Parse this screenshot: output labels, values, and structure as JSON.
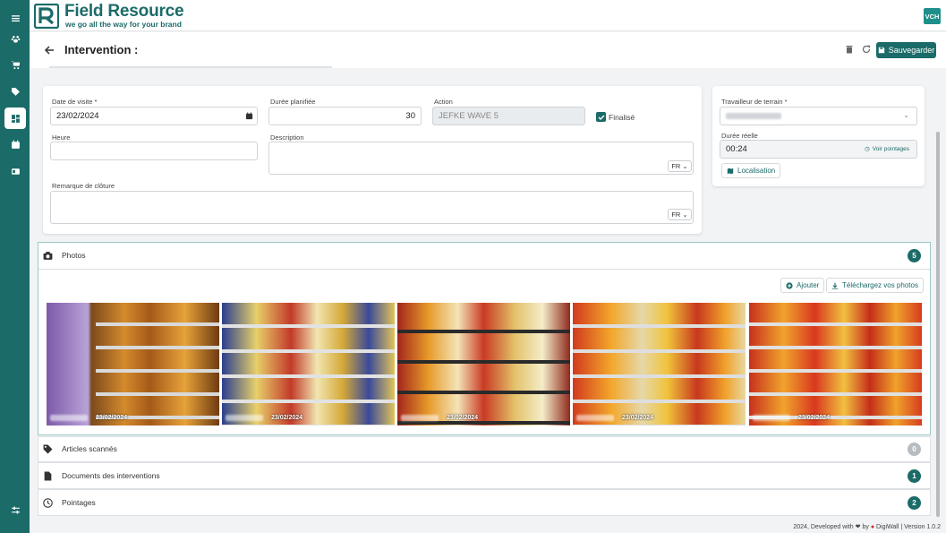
{
  "app": {
    "brand_name": "Field Resource",
    "brand_tagline": "we go all the way for your brand",
    "user_initials": "VCH"
  },
  "colors": {
    "primary": "#1b6b68",
    "badge_teal": "#1e8f8a",
    "badge_grey": "#b7bcc1"
  },
  "sidebar": {
    "items": [
      {
        "icon": "menu-icon"
      },
      {
        "icon": "paw-icon"
      },
      {
        "icon": "cart-icon"
      },
      {
        "icon": "tag-icon"
      },
      {
        "icon": "dashboard-icon",
        "active": true
      },
      {
        "icon": "calendar-icon"
      },
      {
        "icon": "id-card-icon"
      },
      {
        "icon": "sliders-icon"
      }
    ]
  },
  "page": {
    "title": "Intervention :",
    "save_label": "Sauvegarder"
  },
  "form": {
    "date_label": "Date de visite *",
    "date_value": "23/02/2024",
    "duration_label": "Durée planifiée",
    "duration_value": "30",
    "action_label": "Action",
    "action_value": "JEFKE WAVE 5",
    "finalized_label": "Finalisé",
    "finalized_checked": true,
    "hour_label": "Heure",
    "hour_value": "",
    "description_label": "Description",
    "description_lang": "FR",
    "closing_label": "Remarque de clôture",
    "closing_lang": "FR"
  },
  "worker": {
    "field_worker_label": "Travailleur de terrain *",
    "real_duration_label": "Durée réelle",
    "real_duration_value": "00:24",
    "view_timesheets_label": "Voir pointages",
    "location_label": "Localisation"
  },
  "sections": {
    "photos": {
      "label": "Photos",
      "count": "5"
    },
    "scanned": {
      "label": "Articles scannés",
      "count": "0"
    },
    "documents": {
      "label": "Documents des interventions",
      "count": "1"
    },
    "timesheets": {
      "label": "Pointages",
      "count": "2"
    }
  },
  "photos": {
    "add_label": "Ajouter",
    "download_label": "Téléchargez vos photos",
    "items": [
      {
        "date": "23/02/2024"
      },
      {
        "date": "23/02/2024"
      },
      {
        "date": "23/02/2024"
      },
      {
        "date": "23/02/2024"
      },
      {
        "date": "23/02/2024"
      }
    ]
  },
  "footer": {
    "text": "2024, Developed with ❤ by",
    "company": "DigiWall",
    "version": "| Version 1.0.2"
  }
}
